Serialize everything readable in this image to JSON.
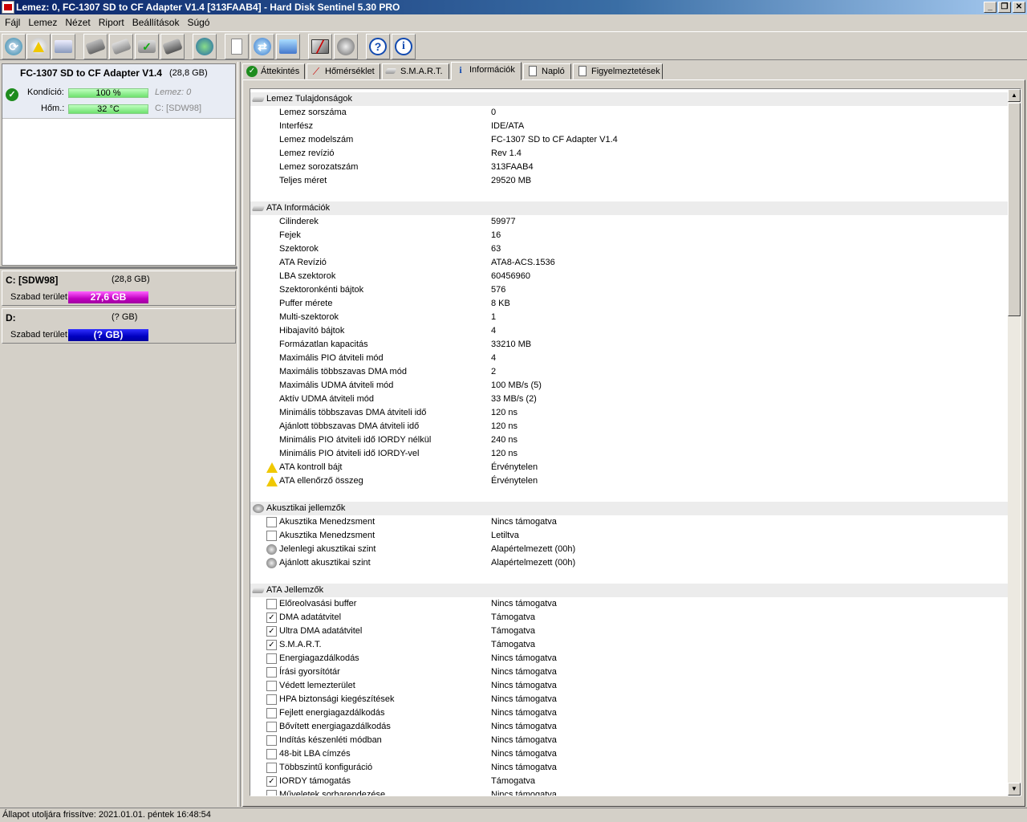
{
  "window": {
    "title": "Lemez: 0, FC-1307 SD to CF Adapter V1.4 [313FAAB4]  -  Hard Disk Sentinel 5.30 PRO",
    "min_glyph": "_",
    "max_glyph": "❐",
    "close_glyph": "✕"
  },
  "menu": [
    "Fájl",
    "Lemez",
    "Nézet",
    "Riport",
    "Beállítások",
    "Súgó"
  ],
  "toolbar": {
    "icons": [
      "refresh-icon",
      "warning-icon",
      "disk-icon",
      "disk-tool-1-icon",
      "disk-tool-2-icon",
      "disk-check-icon",
      "disk-tool-3-icon",
      "globe-icon",
      "report-icon",
      "sync-icon",
      "network-icon",
      "monitor-icon",
      "speaker-icon",
      "help-icon",
      "info-icon"
    ],
    "help_glyph": "?",
    "info_glyph": "i"
  },
  "disk": {
    "title": "FC-1307 SD to CF Adapter V1.4",
    "size": "(28,8 GB)",
    "condition_label": "Kondíció:",
    "condition_value": "100 %",
    "temp_label": "Hőm.:",
    "temp_value": "32 °C",
    "disk_index": "Lemez: 0",
    "drive_ref": "C: [SDW98]"
  },
  "partitions": [
    {
      "name": "C: [SDW98]",
      "size": "(28,8 GB)",
      "free_label": "Szabad terület",
      "free_value": "27,6 GB",
      "color": "#c000c0"
    },
    {
      "name": "D:",
      "size": "(? GB)",
      "free_label": "Szabad terület",
      "free_value": "(? GB)",
      "color": "#0000c0"
    }
  ],
  "tabs": [
    "Áttekintés",
    "Hőmérséklet",
    "S.M.A.R.T.",
    "Információk",
    "Napló",
    "Figyelmeztetések"
  ],
  "active_tab": "Információk",
  "sections": [
    {
      "title": "Lemez Tulajdonságok",
      "rows": [
        {
          "name": "Lemez sorszáma",
          "value": "0"
        },
        {
          "name": "Interfész",
          "value": "IDE/ATA"
        },
        {
          "name": "Lemez modelszám",
          "value": "FC-1307 SD to CF Adapter V1.4"
        },
        {
          "name": "Lemez revízió",
          "value": "Rev 1.4"
        },
        {
          "name": "Lemez sorozatszám",
          "value": "313FAAB4"
        },
        {
          "name": "Teljes méret",
          "value": "29520 MB"
        }
      ]
    },
    {
      "title": "ATA Információk",
      "rows": [
        {
          "name": "Cilinderek",
          "value": "59977"
        },
        {
          "name": "Fejek",
          "value": "16"
        },
        {
          "name": "Szektorok",
          "value": "63"
        },
        {
          "name": "ATA Revízió",
          "value": "ATA8-ACS.1536"
        },
        {
          "name": "LBA szektorok",
          "value": "60456960"
        },
        {
          "name": "Szektoronkénti bájtok",
          "value": "576"
        },
        {
          "name": "Puffer mérete",
          "value": "8 KB"
        },
        {
          "name": "Multi-szektorok",
          "value": "1"
        },
        {
          "name": "Hibajavító bájtok",
          "value": "4"
        },
        {
          "name": "Formázatlan kapacitás",
          "value": "33210 MB"
        },
        {
          "name": "Maximális PIO átviteli mód",
          "value": "4"
        },
        {
          "name": "Maximális többszavas DMA mód",
          "value": "2"
        },
        {
          "name": "Maximális UDMA átviteli mód",
          "value": "100 MB/s (5)"
        },
        {
          "name": "Aktív UDMA átviteli mód",
          "value": "33 MB/s (2)"
        },
        {
          "name": "Minimális többszavas DMA átviteli idő",
          "value": "120 ns"
        },
        {
          "name": "Ajánlott többszavas DMA átviteli idő",
          "value": "120 ns"
        },
        {
          "name": "Minimális PIO átviteli idő IORDY nélkül",
          "value": "240 ns"
        },
        {
          "name": "Minimális PIO átviteli idő IORDY-vel",
          "value": "120 ns"
        },
        {
          "name": "ATA kontroll bájt",
          "value": "Érvénytelen",
          "icon": "warning"
        },
        {
          "name": "ATA ellenőrző összeg",
          "value": "Érvénytelen",
          "icon": "warning"
        }
      ]
    },
    {
      "title": "Akusztikai jellemzők",
      "icon": "speaker",
      "rows": [
        {
          "name": "Akusztika Menedzsment",
          "value": "Nincs támogatva",
          "icon": "checkbox",
          "checked": false
        },
        {
          "name": "Akusztika Menedzsment",
          "value": "Letiltva",
          "icon": "checkbox",
          "checked": false
        },
        {
          "name": "Jelenlegi akusztikai szint",
          "value": "Alapértelmezett (00h)",
          "icon": "speaker"
        },
        {
          "name": "Ajánlott akusztikai szint",
          "value": "Alapértelmezett (00h)",
          "icon": "speaker"
        }
      ]
    },
    {
      "title": "ATA Jellemzők",
      "rows": [
        {
          "name": "Előreolvasási buffer",
          "value": "Nincs támogatva",
          "icon": "checkbox",
          "checked": false
        },
        {
          "name": "DMA adatátvitel",
          "value": "Támogatva",
          "icon": "checkbox",
          "checked": true
        },
        {
          "name": "Ultra DMA adatátvitel",
          "value": "Támogatva",
          "icon": "checkbox",
          "checked": true
        },
        {
          "name": "S.M.A.R.T.",
          "value": "Támogatva",
          "icon": "checkbox",
          "checked": true
        },
        {
          "name": "Energiagazdálkodás",
          "value": "Nincs támogatva",
          "icon": "checkbox",
          "checked": false
        },
        {
          "name": "Írási gyorsítótár",
          "value": "Nincs támogatva",
          "icon": "checkbox",
          "checked": false
        },
        {
          "name": "Védett lemezterület",
          "value": "Nincs támogatva",
          "icon": "checkbox",
          "checked": false
        },
        {
          "name": "HPA biztonsági kiegészítések",
          "value": "Nincs támogatva",
          "icon": "checkbox",
          "checked": false
        },
        {
          "name": "Fejlett energiagazdálkodás",
          "value": "Nincs támogatva",
          "icon": "checkbox",
          "checked": false
        },
        {
          "name": "Bővített energiagazdálkodás",
          "value": "Nincs támogatva",
          "icon": "checkbox",
          "checked": false
        },
        {
          "name": "Indítás készenléti módban",
          "value": "Nincs támogatva",
          "icon": "checkbox",
          "checked": false
        },
        {
          "name": "48-bit LBA címzés",
          "value": "Nincs támogatva",
          "icon": "checkbox",
          "checked": false
        },
        {
          "name": "Többszintű konfiguráció",
          "value": "Nincs támogatva",
          "icon": "checkbox",
          "checked": false
        },
        {
          "name": "IORDY támogatás",
          "value": "Támogatva",
          "icon": "checkbox",
          "checked": true
        },
        {
          "name": "Műveletek sorbarendezése",
          "value": "Nincs támogatva",
          "icon": "checkbox",
          "checked": false
        }
      ]
    }
  ],
  "status": "Állapot utoljára frissítve: 2021.01.01. péntek 16:48:54",
  "scrollbar": {
    "up_glyph": "▲",
    "down_glyph": "▼"
  }
}
